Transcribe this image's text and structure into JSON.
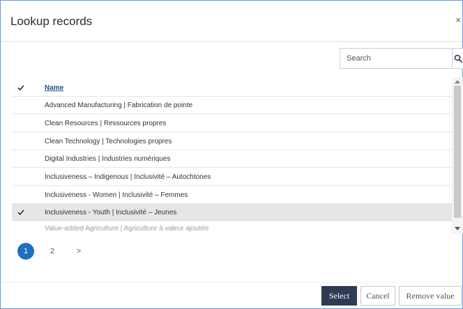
{
  "dialog": {
    "title": "Lookup records",
    "close_label": "×"
  },
  "search": {
    "placeholder": "Search",
    "value": ""
  },
  "table": {
    "column_header": "Name",
    "rows": [
      {
        "label": "Advanced Manufacturing | Fabrication de pointe",
        "selected": false
      },
      {
        "label": "Clean Resources | Ressources propres",
        "selected": false
      },
      {
        "label": "Clean Technology | Technologies propres",
        "selected": false
      },
      {
        "label": "Digital Industries | Industries numériques",
        "selected": false
      },
      {
        "label": "Inclusiveness – Indigenous | Inclusivité – Autochtones",
        "selected": false
      },
      {
        "label": "Inclusiveness - Women | Inclusivité – Femmes",
        "selected": false
      },
      {
        "label": "Inclusiveness - Youth | Inclusivité – Jeunes",
        "selected": true
      },
      {
        "label": "Value-added Agriculture | Agriculture à valeur ajoutée",
        "selected": false
      }
    ]
  },
  "pagination": {
    "pages": [
      "1",
      "2"
    ],
    "current": "1",
    "next_label": ">"
  },
  "buttons": {
    "select": "Select",
    "cancel": "Cancel",
    "remove": "Remove value"
  },
  "colors": {
    "primary_button": "#2f3b52",
    "active_page": "#1f6fbf",
    "selected_row": "#e6e6e6",
    "header_link": "#1b4f8e"
  },
  "icons": {
    "search": "search-icon",
    "close": "close-icon",
    "check": "checkmark-icon"
  }
}
